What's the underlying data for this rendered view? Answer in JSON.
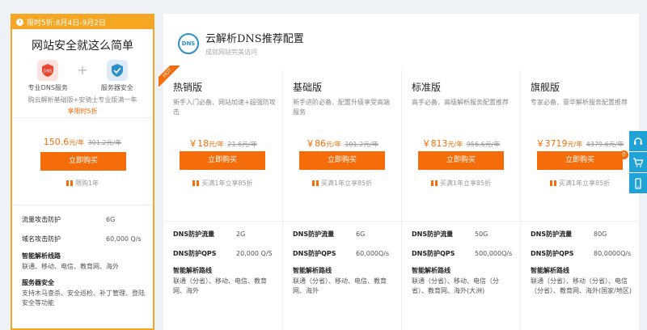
{
  "promo": {
    "banner": "限时5折:8月4日-9月2日",
    "title": "网站安全就这么简单",
    "services": [
      {
        "label": "专业DNS服务",
        "icon": "dns-shield-icon",
        "color": "#e9442f"
      },
      {
        "label": "服务器安全",
        "icon": "server-shield-icon",
        "color": "#2f8fc8"
      }
    ],
    "desc": "购云解析基础版+安骑士专业版满一年",
    "link": "享限时5折",
    "price": "150.6",
    "unit": "元/年",
    "old_price": "301.2元/年",
    "buy_label": "立即购买",
    "note": "限购1年",
    "features": [
      {
        "k": "流量攻击防护",
        "v": "6G"
      },
      {
        "k": "域名攻击防护",
        "v": "60,000 Q/s"
      }
    ],
    "blocks": [
      {
        "t": "智能解析线路",
        "d": "联通、移动、电信、教育网、海外"
      },
      {
        "t": "服务器安全",
        "d": "支持木马查杀、安全巡检、补丁管理、登陆安全等功能"
      }
    ]
  },
  "header": {
    "logo_text": "DNS",
    "title": "云解析DNS推荐配置",
    "subtitle": "成就网站完美访问"
  },
  "hot_label": "HOT",
  "plans": [
    {
      "name": "热销版",
      "desc": "新手入门必备、网站加速+超强防攻击",
      "price": "18",
      "old_price": "21.6元/年",
      "buy_label": "立即购买",
      "note": "买满1年立享85折",
      "flow": "2G",
      "qps": "20,000 Q/S",
      "lines": "联通（分省）、移动、电信、教育网、海外"
    },
    {
      "name": "基础版",
      "desc": "新手进阶必备、配置升级享受高端服务",
      "price": "86",
      "old_price": "101.2元/年",
      "buy_label": "立即购买",
      "note": "买满1年立享85折",
      "flow": "6G",
      "qps": "60,000Q/s",
      "lines": "联通（分省）、移动、电信、教育网、海外"
    },
    {
      "name": "标准版",
      "desc": "高手必备、高级解析服务配置推荐",
      "price": "813",
      "old_price": "956.6元/年",
      "buy_label": "立即购买",
      "note": "买满1年立享85折",
      "flow": "50G",
      "qps": "500,000Q/s",
      "lines": "联通（分省）、移动、电信（分省）、教育网、海外(大洲)"
    },
    {
      "name": "旗舰版",
      "desc": "专家必备、豪华解析服务配置推荐",
      "price": "3719",
      "old_price": "4379.6元/年",
      "buy_label": "立即购买",
      "note": "买满1年立享85折",
      "flow": "80G",
      "qps": "80,0000Q/s",
      "lines": "联通（分省）、移动（分省）、电信（分省）、教育网、海外(国家/地区)"
    }
  ],
  "labels": {
    "currency": "￥",
    "unit": "元/年",
    "flow_key": "DNS防护流量",
    "qps_key": "DNS防护QPS",
    "lines_key": "智能解析路线"
  },
  "float": {
    "badge": "0",
    "buttons": [
      "support-icon",
      "cart-icon",
      "mobile-icon"
    ]
  },
  "colors": {
    "accent": "#f56c0a",
    "promo_border": "#f5a623",
    "float": "#1fa3d6"
  }
}
